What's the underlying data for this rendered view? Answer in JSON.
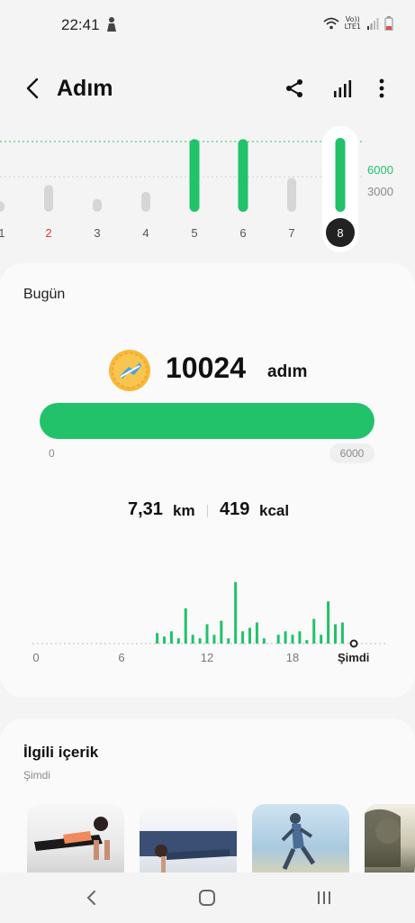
{
  "status_bar": {
    "time": "22:41",
    "network_line1": "Vo))",
    "network_line2": "LTE1"
  },
  "header": {
    "title": "Adım",
    "icons": [
      "back-icon",
      "share-icon",
      "bar-chart-icon",
      "more-vert-icon"
    ]
  },
  "week_chart": {
    "goal_label": "6000",
    "ref_label": "3000",
    "days": [
      "/1",
      "2",
      "3",
      "4",
      "5",
      "6",
      "7",
      "8"
    ],
    "highlight_day": "2",
    "selected_day": "8"
  },
  "today": {
    "title": "Bugün",
    "steps": "10024",
    "unit": "adım",
    "progress_min": "0",
    "progress_max": "6000",
    "progress_fraction": 1.0,
    "distance": "7,31",
    "distance_unit": "km",
    "calories": "419",
    "calories_unit": "kcal",
    "hour_ticks": [
      "0",
      "6",
      "12",
      "18"
    ],
    "now_label": "Şimdi"
  },
  "chart_data": {
    "type": "bar",
    "x_label_ticks": [
      "0",
      "6",
      "12",
      "18",
      "Şimdi"
    ],
    "hours": [
      8,
      8.5,
      9,
      9.5,
      10,
      10.5,
      11,
      11.5,
      12,
      12.5,
      13,
      13.5,
      14,
      14.5,
      15,
      15.5,
      16,
      16.5,
      17,
      17.5,
      18,
      18.5,
      19,
      19.5,
      20,
      20.5,
      21,
      21.5,
      22
    ],
    "values": [
      0,
      12,
      8,
      14,
      6,
      40,
      10,
      6,
      22,
      10,
      26,
      6,
      70,
      14,
      18,
      24,
      6,
      0,
      10,
      14,
      10,
      14,
      4,
      28,
      10,
      48,
      22,
      24,
      0
    ],
    "ylim": [
      0,
      80
    ],
    "week": {
      "categories": [
        "/1",
        "2",
        "3",
        "4",
        "5",
        "6",
        "7",
        "8"
      ],
      "values": [
        900,
        2300,
        1100,
        1700,
        6200,
        6200,
        2900,
        10024
      ],
      "goal": 6000
    }
  },
  "related": {
    "title": "İlgili içerik",
    "subtitle": "Şimdi"
  },
  "colors": {
    "accent": "#21c26a",
    "bar_inactive": "#d6d6d6",
    "highlight_red": "#e03b3b"
  }
}
